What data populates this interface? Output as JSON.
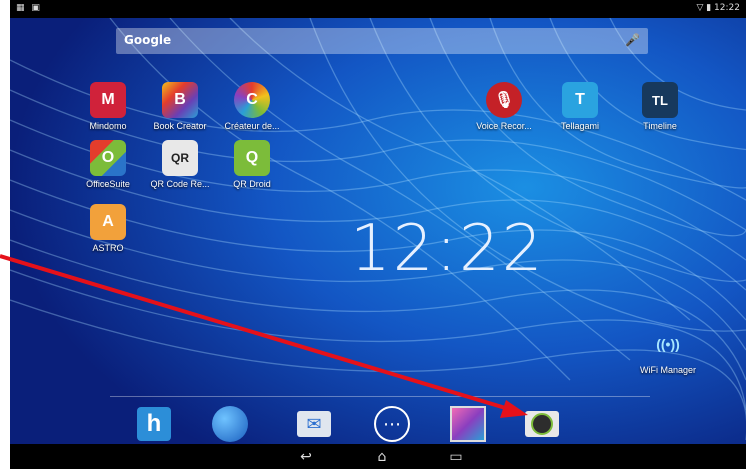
{
  "status": {
    "left_icons": "▦ ▣",
    "right_text": "▽ ▮ 12:22"
  },
  "search": {
    "label": "Google",
    "mic": "🎤"
  },
  "apps": [
    {
      "label": "Mindomo",
      "color": "#d0223a",
      "glyph": "M"
    },
    {
      "label": "Book Creator",
      "color": "#6a3fb5",
      "glyph": "B"
    },
    {
      "label": "Créateur de...",
      "color": "#e43d2c",
      "glyph": "C"
    },
    {
      "label": "OfficeSuite",
      "color": "#2a74c9",
      "glyph": "O"
    },
    {
      "label": "QR Code Re...",
      "color": "#dddddd",
      "glyph": "QR"
    },
    {
      "label": "QR Droid",
      "color": "#7cbc3a",
      "glyph": "Q"
    },
    {
      "label": "ASTRO",
      "color": "#f2a13b",
      "glyph": "A"
    },
    {
      "label": "Voice Recor...",
      "color": "#c42127",
      "glyph": "🎙"
    },
    {
      "label": "Tellagami",
      "color": "#2aa3e0",
      "glyph": "T"
    },
    {
      "label": "Timeline",
      "color": "#17395d",
      "glyph": "TL"
    },
    {
      "label": "WiFi Manager",
      "color": "transparent",
      "glyph": "((•))"
    }
  ],
  "clock": "12:22",
  "dock": [
    {
      "name": "hootsuite-icon",
      "glyph": "h",
      "color": "#2c8ed8"
    },
    {
      "name": "earth-icon",
      "glyph": "🌐",
      "color": "#ffffff"
    },
    {
      "name": "mail-icon",
      "glyph": "✉",
      "color": "#e0e6ef"
    },
    {
      "name": "app-drawer-icon",
      "glyph": "⋯",
      "color": "#ffffff"
    },
    {
      "name": "gallery-icon",
      "glyph": "▣",
      "color": "#8a3fbf"
    },
    {
      "name": "camera-icon",
      "glyph": "◉",
      "color": "#2d2d2d"
    }
  ],
  "nav": {
    "back": "↩",
    "home": "⌂",
    "recent": "▭"
  },
  "colors": {
    "arrow": "#e5111a",
    "wallpaper": "#0a2b8f"
  }
}
